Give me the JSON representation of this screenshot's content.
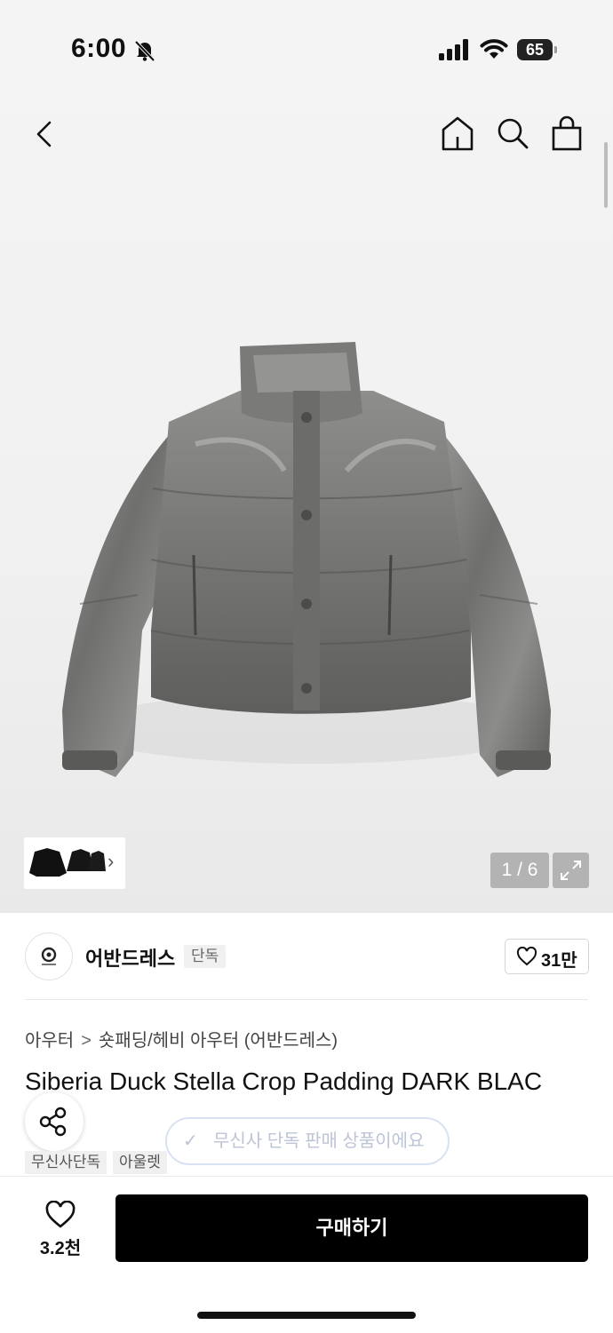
{
  "status_bar": {
    "time": "6:00",
    "battery": "65",
    "battery_level": 0.65
  },
  "nav": {
    "icons": [
      "back-icon",
      "home-icon",
      "search-icon",
      "shopping-bag-icon"
    ]
  },
  "gallery": {
    "pager": "1 / 6",
    "thumb_chevron": "›"
  },
  "brand": {
    "name": "어반드레스",
    "badge": "단독",
    "likes": "31만"
  },
  "product": {
    "breadcrumb": [
      "아우터",
      "숏패딩/헤비 아우터 (어반드레스)"
    ],
    "breadcrumb_sep": ">",
    "title": "Siberia Duck Stella Crop Padding DARK BLAC",
    "tags": [
      "무신사단독",
      "아울렛"
    ],
    "exclusive_toast": "무신사 단독 판매 상품이에요",
    "toast_check": "✓"
  },
  "bottom_bar": {
    "wish_count": "3.2천",
    "buy_label": "구매하기"
  },
  "colors": {
    "buy_button": "#000000",
    "hero_bg": "#f1f1f1"
  }
}
